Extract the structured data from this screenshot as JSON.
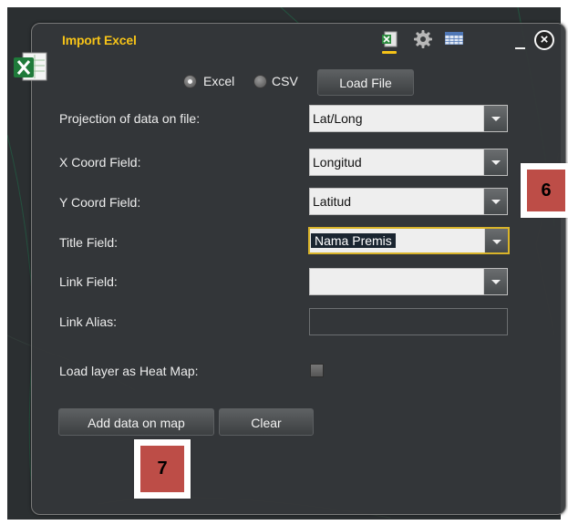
{
  "window": {
    "title": "Import Excel",
    "close_glyph": "×",
    "header_icons": [
      "excel-icon",
      "gear-icon",
      "table-icon"
    ]
  },
  "source": {
    "options": [
      "Excel",
      "CSV"
    ],
    "selected": "Excel",
    "load_label": "Load File"
  },
  "form": {
    "projection_label": "Projection of data on file:",
    "projection_value": "Lat/Long",
    "x_label": "X Coord Field:",
    "x_value": "Longitud",
    "y_label": "Y Coord Field:",
    "y_value": "Latitud",
    "title_label": "Title Field:",
    "title_value": "Nama Premis",
    "link_label": "Link Field:",
    "link_value": "",
    "alias_label": "Link Alias:",
    "alias_value": "",
    "heatmap_label": "Load layer as Heat Map:",
    "heatmap_checked": false
  },
  "actions": {
    "add_label": "Add data on map",
    "clear_label": "Clear"
  },
  "callouts": {
    "six": "6",
    "seven": "7"
  },
  "colors": {
    "accent": "#f6c318",
    "callout": "#bd4d47",
    "panel": "#343739"
  }
}
